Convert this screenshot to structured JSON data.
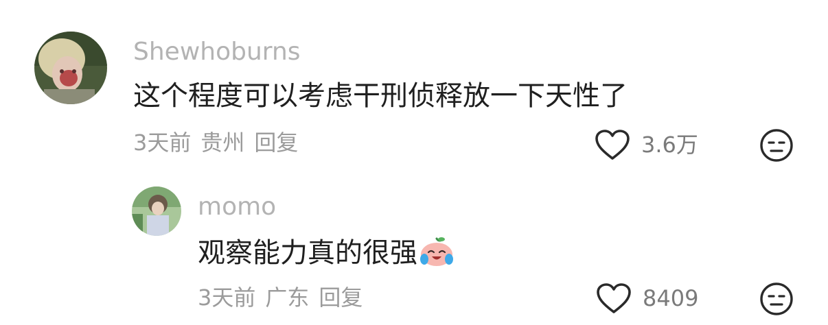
{
  "comments": [
    {
      "username": "Shewhoburns",
      "text": "这个程度可以考虑干刑侦释放一下天性了",
      "time": "3天前",
      "location": "贵州",
      "reply_label": "回复",
      "like_count": "3.6万"
    },
    {
      "username": "momo",
      "text": "观察能力真的很强",
      "time": "3天前",
      "location": "广东",
      "reply_label": "回复",
      "like_count": "8409",
      "emoji_icon": "laughing-crying-peach-emoji"
    }
  ],
  "icons": {
    "like": "heart-outline-icon",
    "dislike": "meh-face-icon"
  },
  "colors": {
    "username": "#b3b3b3",
    "text": "#1f1f1f",
    "meta": "#9b9b9b",
    "icon_stroke": "#2a2a2a"
  }
}
